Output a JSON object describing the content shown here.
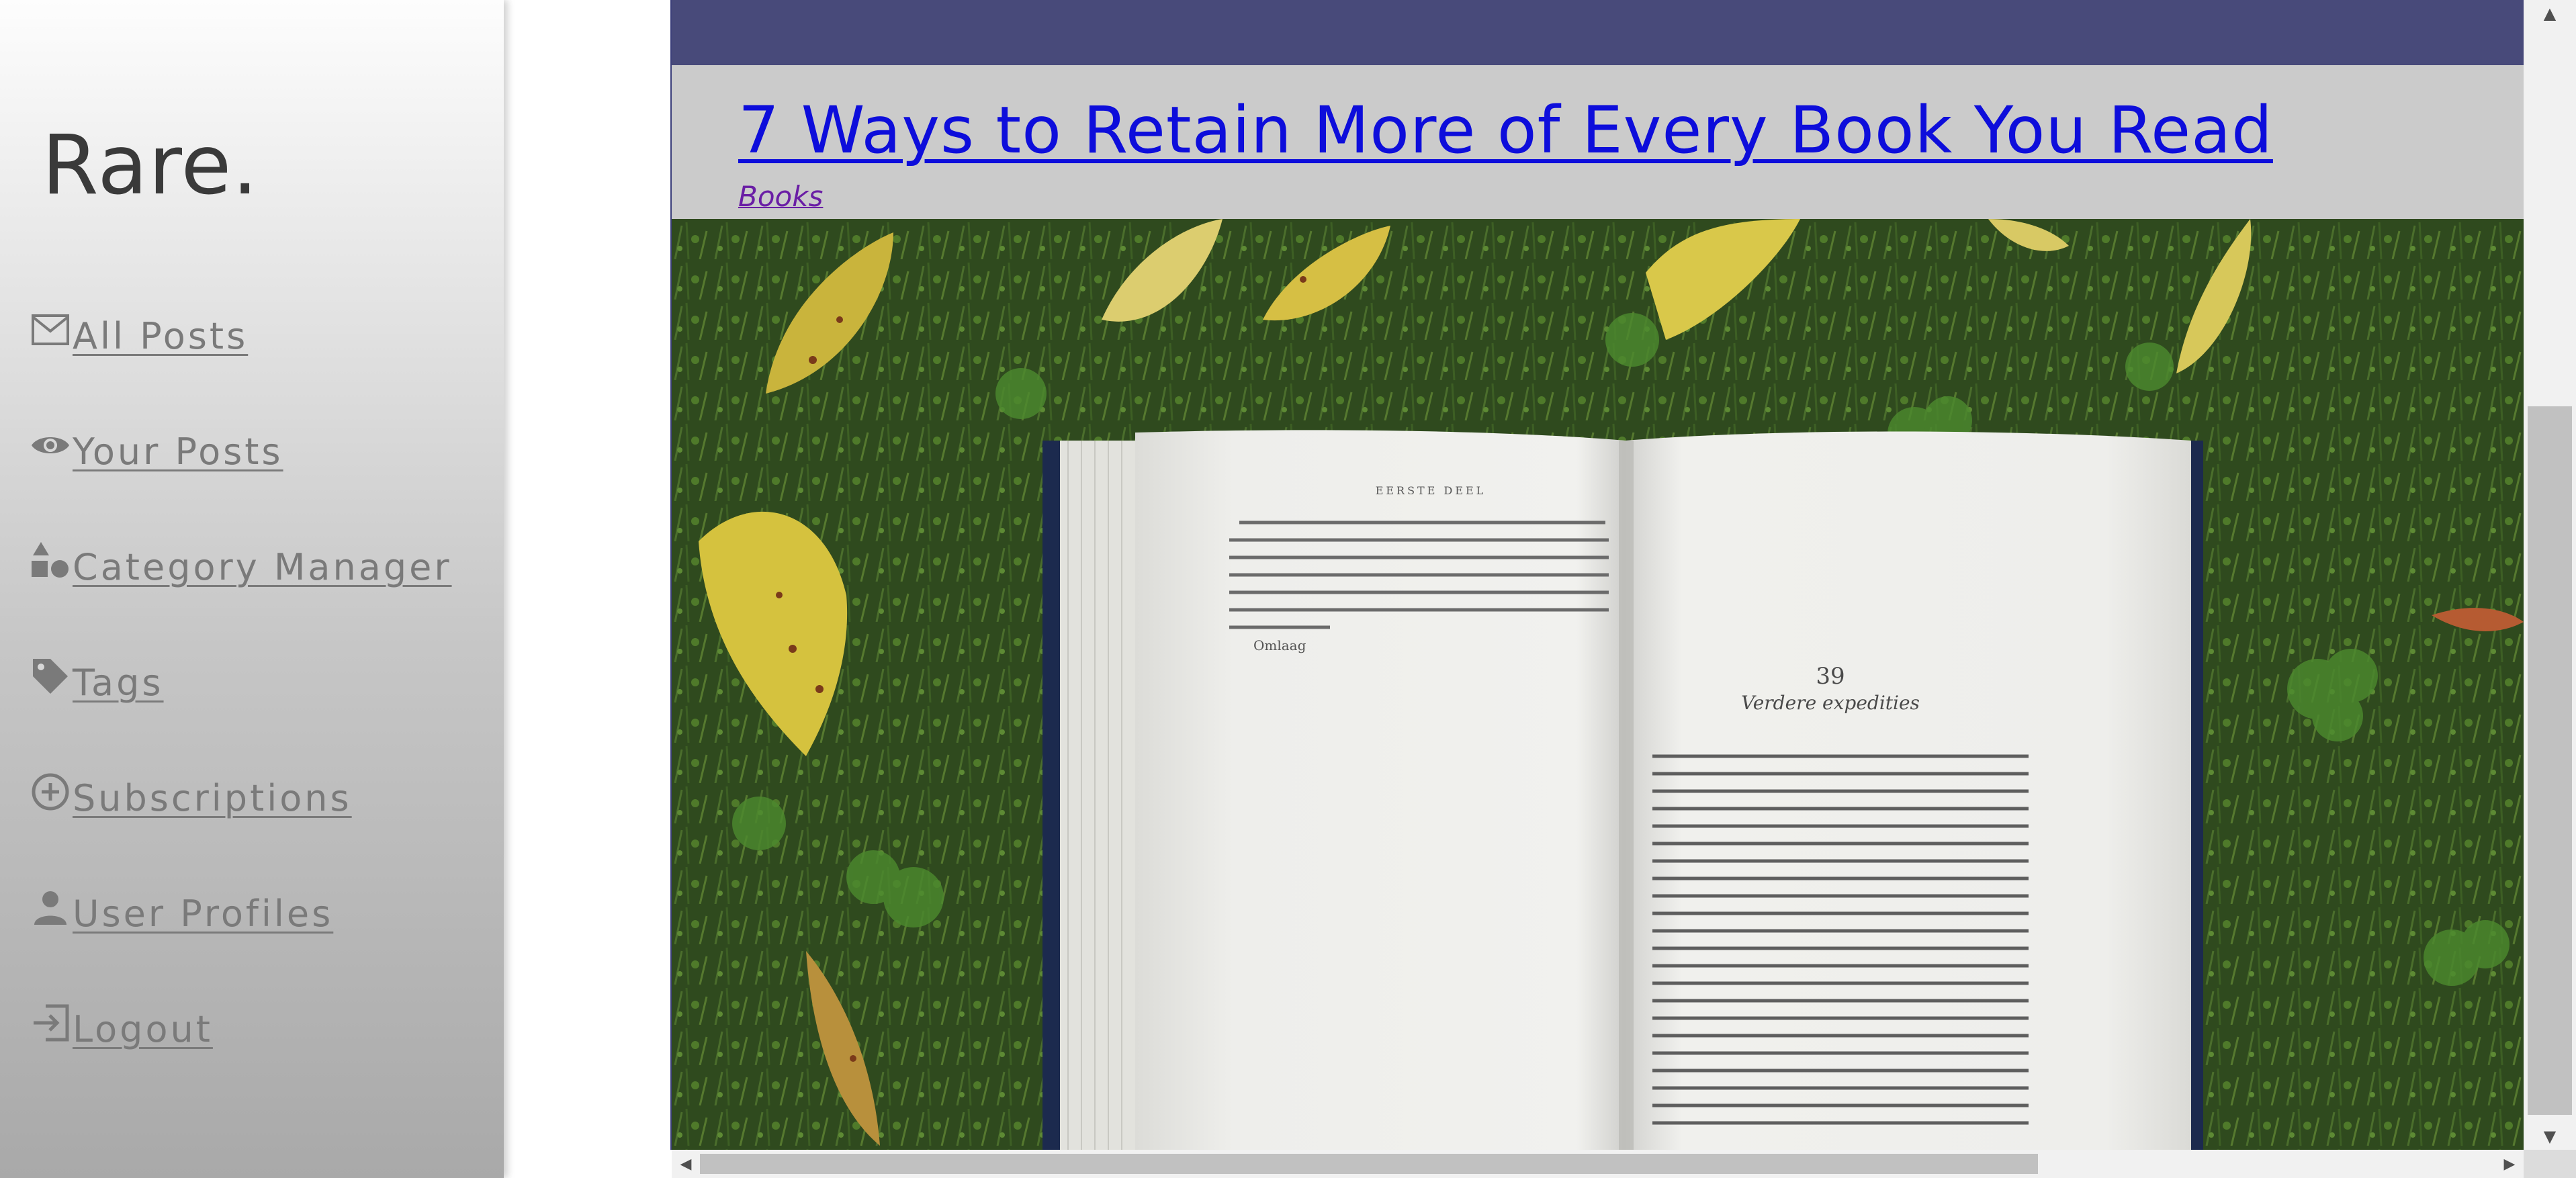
{
  "sidebar": {
    "brand": "Rare.",
    "items": [
      {
        "label": "All Posts",
        "icon": "mail-icon"
      },
      {
        "label": "Your Posts",
        "icon": "eye-icon"
      },
      {
        "label": "Category Manager",
        "icon": "category-icon"
      },
      {
        "label": "Tags",
        "icon": "tag-icon"
      },
      {
        "label": "Subscriptions",
        "icon": "add-circle-icon"
      },
      {
        "label": "User Profiles",
        "icon": "person-icon"
      },
      {
        "label": "Logout",
        "icon": "logout-icon"
      }
    ]
  },
  "post": {
    "title": "7 Ways to Retain More of Every Book You Read",
    "category": "Books",
    "image_text": {
      "running_head": "EERSTE DEEL",
      "chapter_number": "39",
      "chapter_title": "Verdere expedities",
      "footer_left": "Omlaag"
    }
  },
  "colors": {
    "header_bar": "#484a7a",
    "post_background": "#cbcbcb",
    "title_link": "#0d0ddb",
    "category_link": "#6a1ea5",
    "sidebar_text": "#7a7a7a"
  }
}
